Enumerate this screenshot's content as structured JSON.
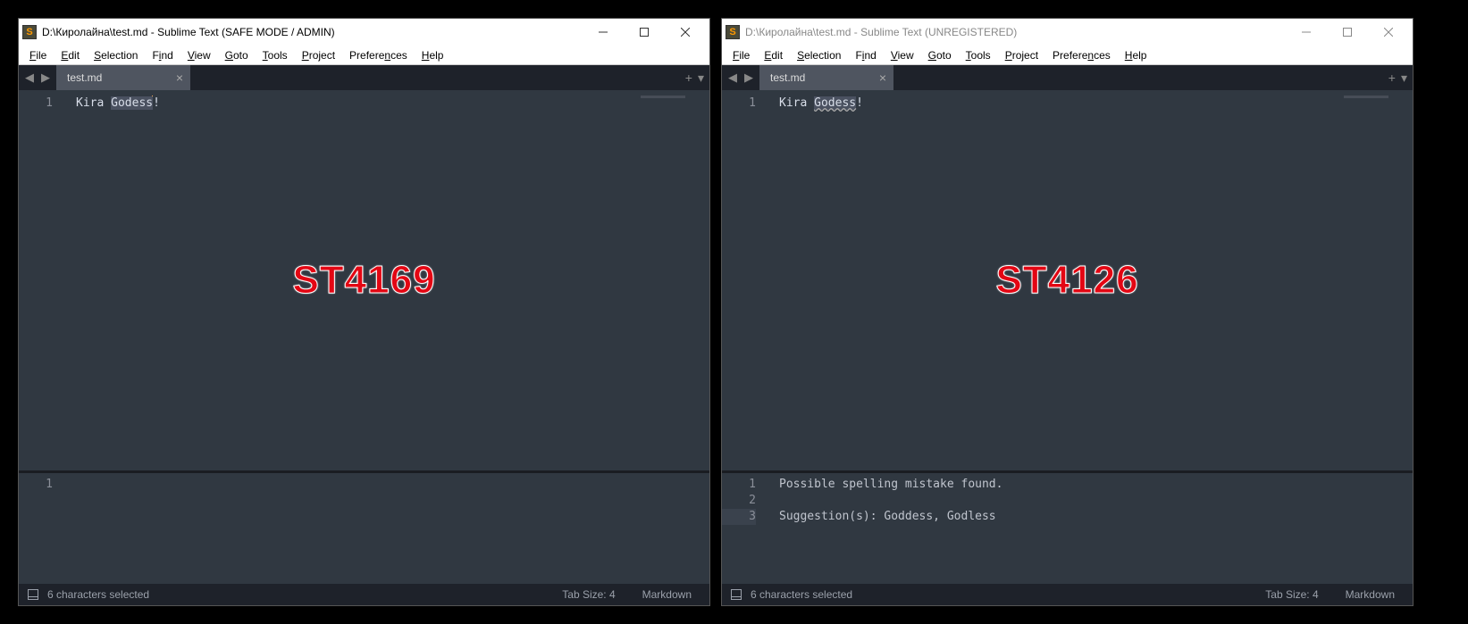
{
  "left": {
    "title": "D:\\Киролайна\\test.md - Sublime Text (SAFE MODE / ADMIN)",
    "overlay": "ST4169",
    "menu": [
      "File",
      "Edit",
      "Selection",
      "Find",
      "View",
      "Goto",
      "Tools",
      "Project",
      "Preferences",
      "Help"
    ],
    "tab": "test.md",
    "line_number": "1",
    "code_prefix": "Kira ",
    "code_sel": "Godess",
    "code_suffix": "!",
    "output_lines": [
      {
        "n": "1",
        "t": ""
      }
    ],
    "status_left": "6 characters selected",
    "status_tab": "Tab Size: 4",
    "status_lang": "Markdown"
  },
  "right": {
    "title": "D:\\Киролайна\\test.md - Sublime Text (UNREGISTERED)",
    "overlay": "ST4126",
    "menu": [
      "File",
      "Edit",
      "Selection",
      "Find",
      "View",
      "Goto",
      "Tools",
      "Project",
      "Preferences",
      "Help"
    ],
    "tab": "test.md",
    "line_number": "1",
    "code_prefix": "Kira ",
    "code_sel": "Godess",
    "code_suffix": "!",
    "output_lines": [
      {
        "n": "1",
        "t": "Possible spelling mistake found."
      },
      {
        "n": "2",
        "t": ""
      },
      {
        "n": "3",
        "t": "Suggestion(s): Goddess, Godless"
      }
    ],
    "status_left": "6 characters selected",
    "status_tab": "Tab Size: 4",
    "status_lang": "Markdown"
  }
}
